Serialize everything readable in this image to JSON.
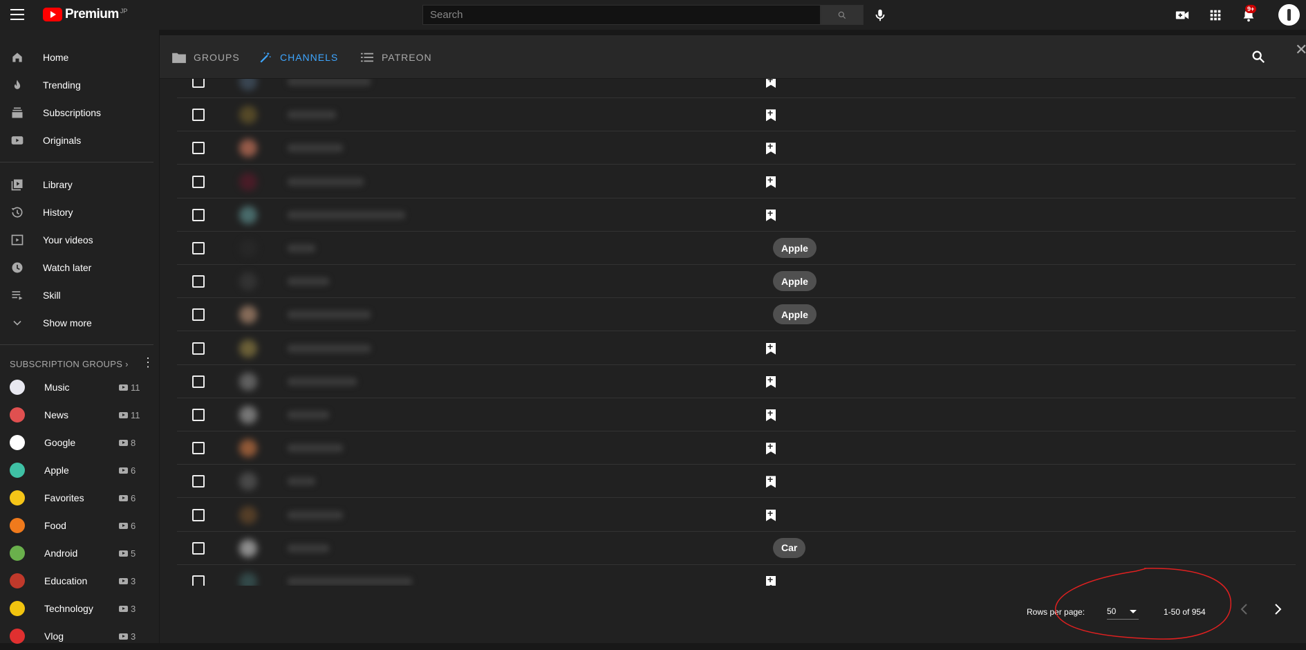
{
  "masthead": {
    "logo_text": "Premium",
    "logo_sup": "JP",
    "search_placeholder": "Search",
    "notification_badge": "9+"
  },
  "sidebar": {
    "main": [
      {
        "label": "Home",
        "icon": "home-icon"
      },
      {
        "label": "Trending",
        "icon": "trending-icon"
      },
      {
        "label": "Subscriptions",
        "icon": "subscriptions-icon"
      },
      {
        "label": "Originals",
        "icon": "originals-icon"
      }
    ],
    "library": [
      {
        "label": "Library",
        "icon": "library-icon"
      },
      {
        "label": "History",
        "icon": "history-icon"
      },
      {
        "label": "Your videos",
        "icon": "your-videos-icon"
      },
      {
        "label": "Watch later",
        "icon": "watch-later-icon"
      },
      {
        "label": "Skill",
        "icon": "playlist-icon"
      },
      {
        "label": "Show more",
        "icon": "chevron-down-icon"
      }
    ],
    "groups_header": "SUBSCRIPTION GROUPS",
    "groups_header_arrow": "›",
    "groups": [
      {
        "label": "Music",
        "count": "11",
        "color": "#e8e8f0"
      },
      {
        "label": "News",
        "count": "11",
        "color": "#e05050"
      },
      {
        "label": "Google",
        "count": "8",
        "color": "#ffffff"
      },
      {
        "label": "Apple",
        "count": "6",
        "color": "#3fc1a5"
      },
      {
        "label": "Favorites",
        "count": "6",
        "color": "#f5c518"
      },
      {
        "label": "Food",
        "count": "6",
        "color": "#f07a1c"
      },
      {
        "label": "Android",
        "count": "5",
        "color": "#6ab04c"
      },
      {
        "label": "Education",
        "count": "3",
        "color": "#c0392b"
      },
      {
        "label": "Technology",
        "count": "3",
        "color": "#f1c40f"
      },
      {
        "label": "Vlog",
        "count": "3",
        "color": "#e03030"
      }
    ]
  },
  "panel": {
    "tabs": [
      {
        "label": "GROUPS",
        "active": false
      },
      {
        "label": "CHANNELS",
        "active": true
      },
      {
        "label": "PATREON",
        "active": false
      }
    ],
    "close_label": "✕",
    "rows": [
      {
        "tag": "",
        "thumb": "#445566",
        "w": 120
      },
      {
        "tag": "",
        "thumb": "#6b5a2a",
        "w": 70
      },
      {
        "tag": "",
        "thumb": "#c7735a",
        "w": 80
      },
      {
        "tag": "",
        "thumb": "#5a1a2a",
        "w": 110
      },
      {
        "tag": "",
        "thumb": "#5a8a8a",
        "w": 170
      },
      {
        "tag": "Apple",
        "thumb": "#2a2a2a",
        "w": 40
      },
      {
        "tag": "Apple",
        "thumb": "#3a3a3a",
        "w": 60
      },
      {
        "tag": "Apple",
        "thumb": "#b08a70",
        "w": 120
      },
      {
        "tag": "",
        "thumb": "#8a7a40",
        "w": 120
      },
      {
        "tag": "",
        "thumb": "#7a7a7a",
        "w": 100
      },
      {
        "tag": "",
        "thumb": "#9a9a9a",
        "w": 60
      },
      {
        "tag": "",
        "thumb": "#c07040",
        "w": 80
      },
      {
        "tag": "",
        "thumb": "#5a5a5a",
        "w": 40
      },
      {
        "tag": "",
        "thumb": "#6a4a2a",
        "w": 80
      },
      {
        "tag": "Car",
        "thumb": "#bbbbbb",
        "w": 60
      },
      {
        "tag": "",
        "thumb": "#3a5a5a",
        "w": 180
      }
    ],
    "footer": {
      "rows_per_page_label": "Rows per page:",
      "rows_per_page_value": "50",
      "range": "1-50 of 954"
    }
  }
}
